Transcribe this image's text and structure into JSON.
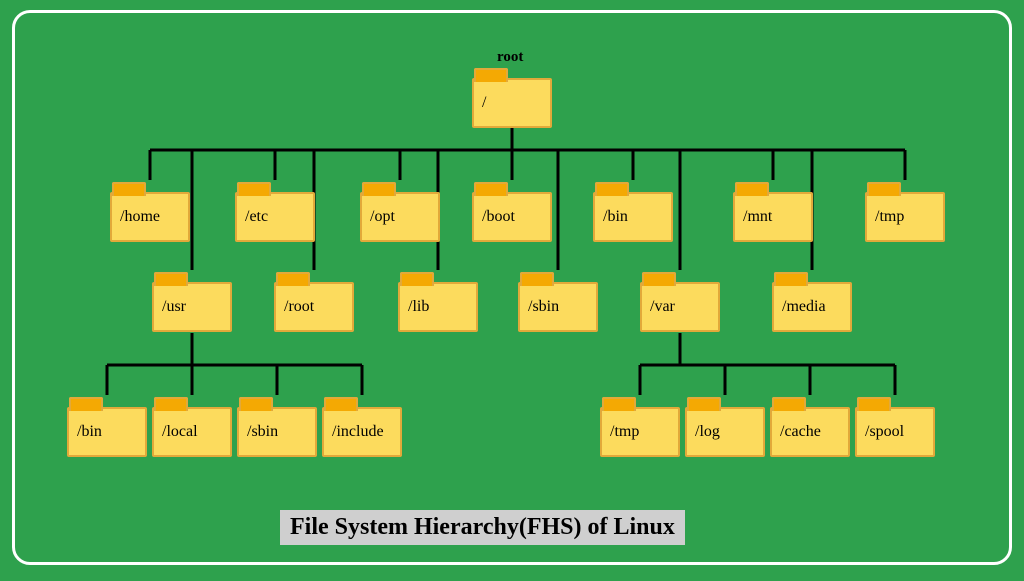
{
  "caption": "File System Hierarchy(FHS) of Linux",
  "root": {
    "title": "root",
    "label": "/"
  },
  "level1_top": [
    {
      "label": "/home"
    },
    {
      "label": "/etc"
    },
    {
      "label": "/opt"
    },
    {
      "label": "/boot"
    },
    {
      "label": "/bin"
    },
    {
      "label": "/mnt"
    },
    {
      "label": "/tmp"
    }
  ],
  "level1_bottom": [
    {
      "label": "/usr"
    },
    {
      "label": "/root"
    },
    {
      "label": "/lib"
    },
    {
      "label": "/sbin"
    },
    {
      "label": "/var"
    },
    {
      "label": "/media"
    }
  ],
  "usr_children": [
    {
      "label": "/bin"
    },
    {
      "label": "/local"
    },
    {
      "label": "/sbin"
    },
    {
      "label": "/include"
    }
  ],
  "var_children": [
    {
      "label": "/tmp"
    },
    {
      "label": "/log"
    },
    {
      "label": "/cache"
    },
    {
      "label": "/spool"
    }
  ]
}
